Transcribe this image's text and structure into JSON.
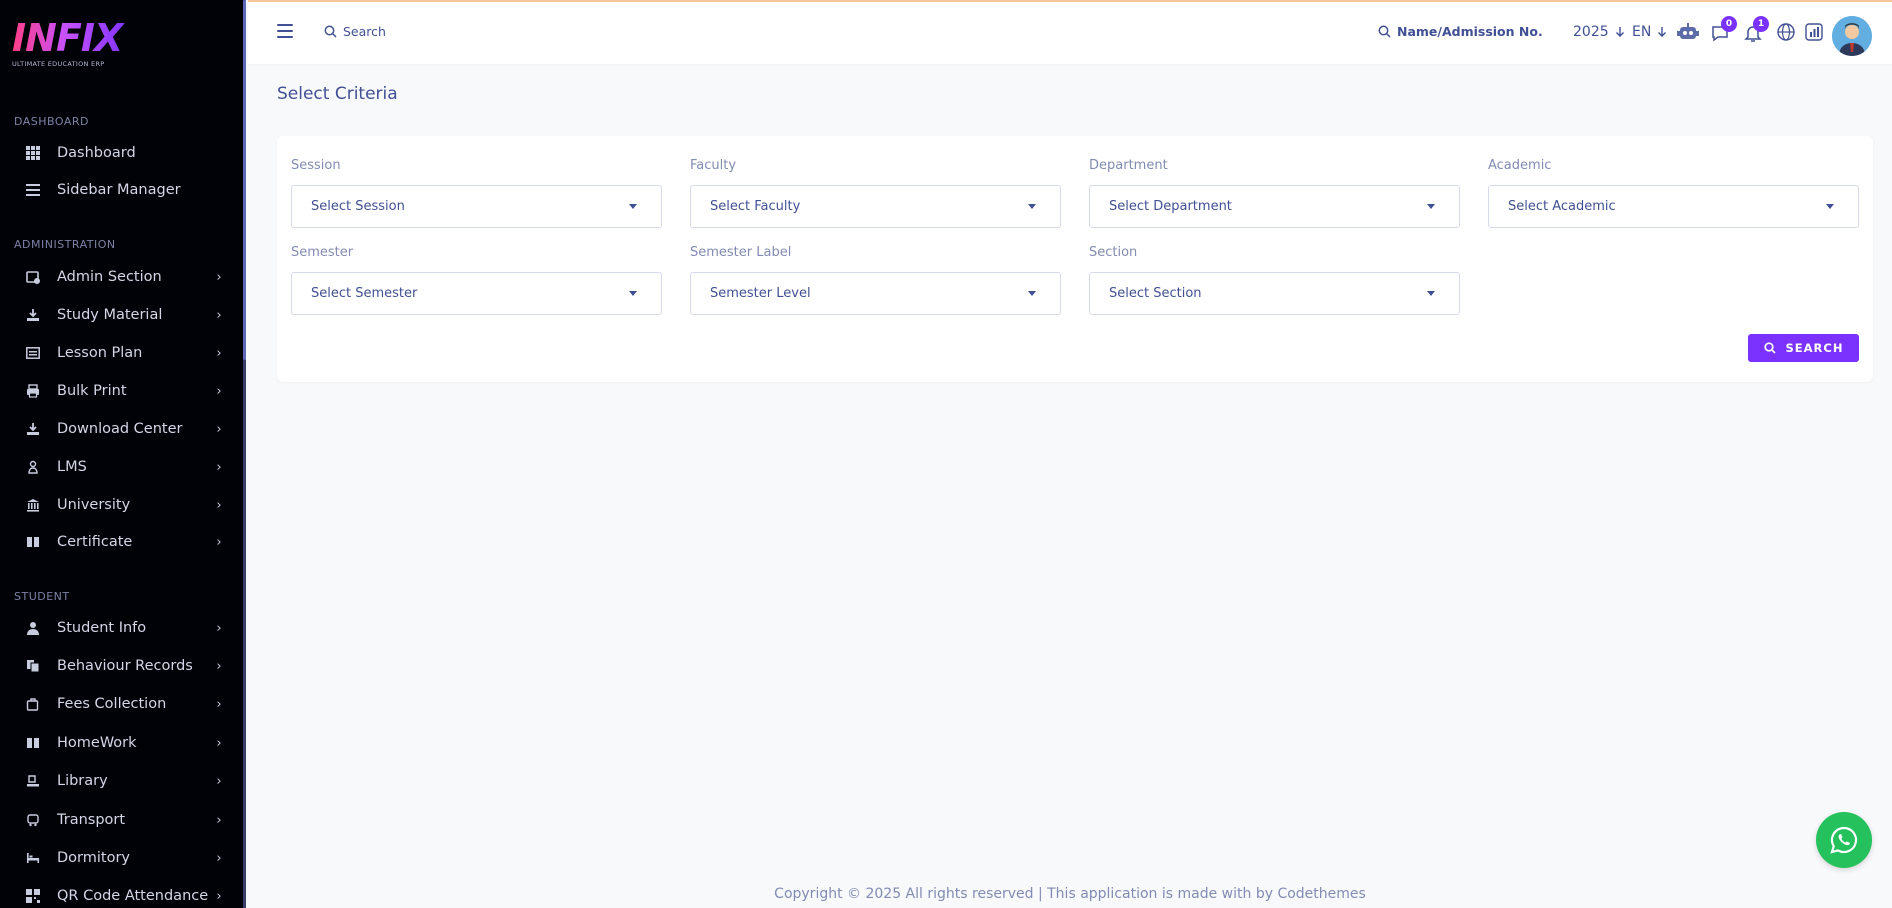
{
  "brand": {
    "logo_text": "INFIX",
    "tagline": "ULTIMATE EDUCATION ERP"
  },
  "sidebar": {
    "sections": [
      {
        "label": "DASHBOARD",
        "items": [
          {
            "label": "Dashboard",
            "icon": "grid-icon",
            "has_children": false
          },
          {
            "label": "Sidebar Manager",
            "icon": "list-icon",
            "has_children": false
          }
        ]
      },
      {
        "label": "ADMINISTRATION",
        "items": [
          {
            "label": "Admin Section",
            "icon": "admin-icon",
            "has_children": true
          },
          {
            "label": "Study Material",
            "icon": "download-icon",
            "has_children": true
          },
          {
            "label": "Lesson Plan",
            "icon": "lesson-icon",
            "has_children": true
          },
          {
            "label": "Bulk Print",
            "icon": "printer-icon",
            "has_children": true
          },
          {
            "label": "Download Center",
            "icon": "download-icon",
            "has_children": true
          },
          {
            "label": "LMS",
            "icon": "lms-icon",
            "has_children": true
          },
          {
            "label": "University",
            "icon": "university-icon",
            "has_children": true
          },
          {
            "label": "Certificate",
            "icon": "book-icon",
            "has_children": true
          }
        ]
      },
      {
        "label": "STUDENT",
        "items": [
          {
            "label": "Student Info",
            "icon": "user-icon",
            "has_children": true
          },
          {
            "label": "Behaviour Records",
            "icon": "records-icon",
            "has_children": true
          },
          {
            "label": "Fees Collection",
            "icon": "fees-icon",
            "has_children": true
          },
          {
            "label": "HomeWork",
            "icon": "book-icon",
            "has_children": true
          },
          {
            "label": "Library",
            "icon": "library-icon",
            "has_children": true
          },
          {
            "label": "Transport",
            "icon": "bus-icon",
            "has_children": true
          },
          {
            "label": "Dormitory",
            "icon": "bed-icon",
            "has_children": true
          },
          {
            "label": "QR Code Attendance",
            "icon": "qr-icon",
            "has_children": true
          }
        ]
      }
    ]
  },
  "topbar": {
    "search_label": "Search",
    "student_search_label": "Name/Admission No.",
    "year": "2025",
    "language": "EN",
    "messages_count": "0",
    "notifications_count": "1"
  },
  "main": {
    "title": "Select Criteria",
    "fields": [
      {
        "label": "Session",
        "value": "Select Session"
      },
      {
        "label": "Faculty",
        "value": "Select Faculty"
      },
      {
        "label": "Department",
        "value": "Select Department"
      },
      {
        "label": "Academic",
        "value": "Select Academic"
      },
      {
        "label": "Semester",
        "value": "Select Semester"
      },
      {
        "label": "Semester Label",
        "value": "Semester Level"
      },
      {
        "label": "Section",
        "value": "Select Section"
      }
    ],
    "search_button": "SEARCH"
  },
  "footer": {
    "text": "Copyright © 2025 All rights reserved | This application is made with by Codethemes"
  },
  "colors": {
    "accent": "#7c32ff",
    "sidebar_bg": "#010207",
    "text": "#415094",
    "whatsapp": "#25c15c"
  }
}
